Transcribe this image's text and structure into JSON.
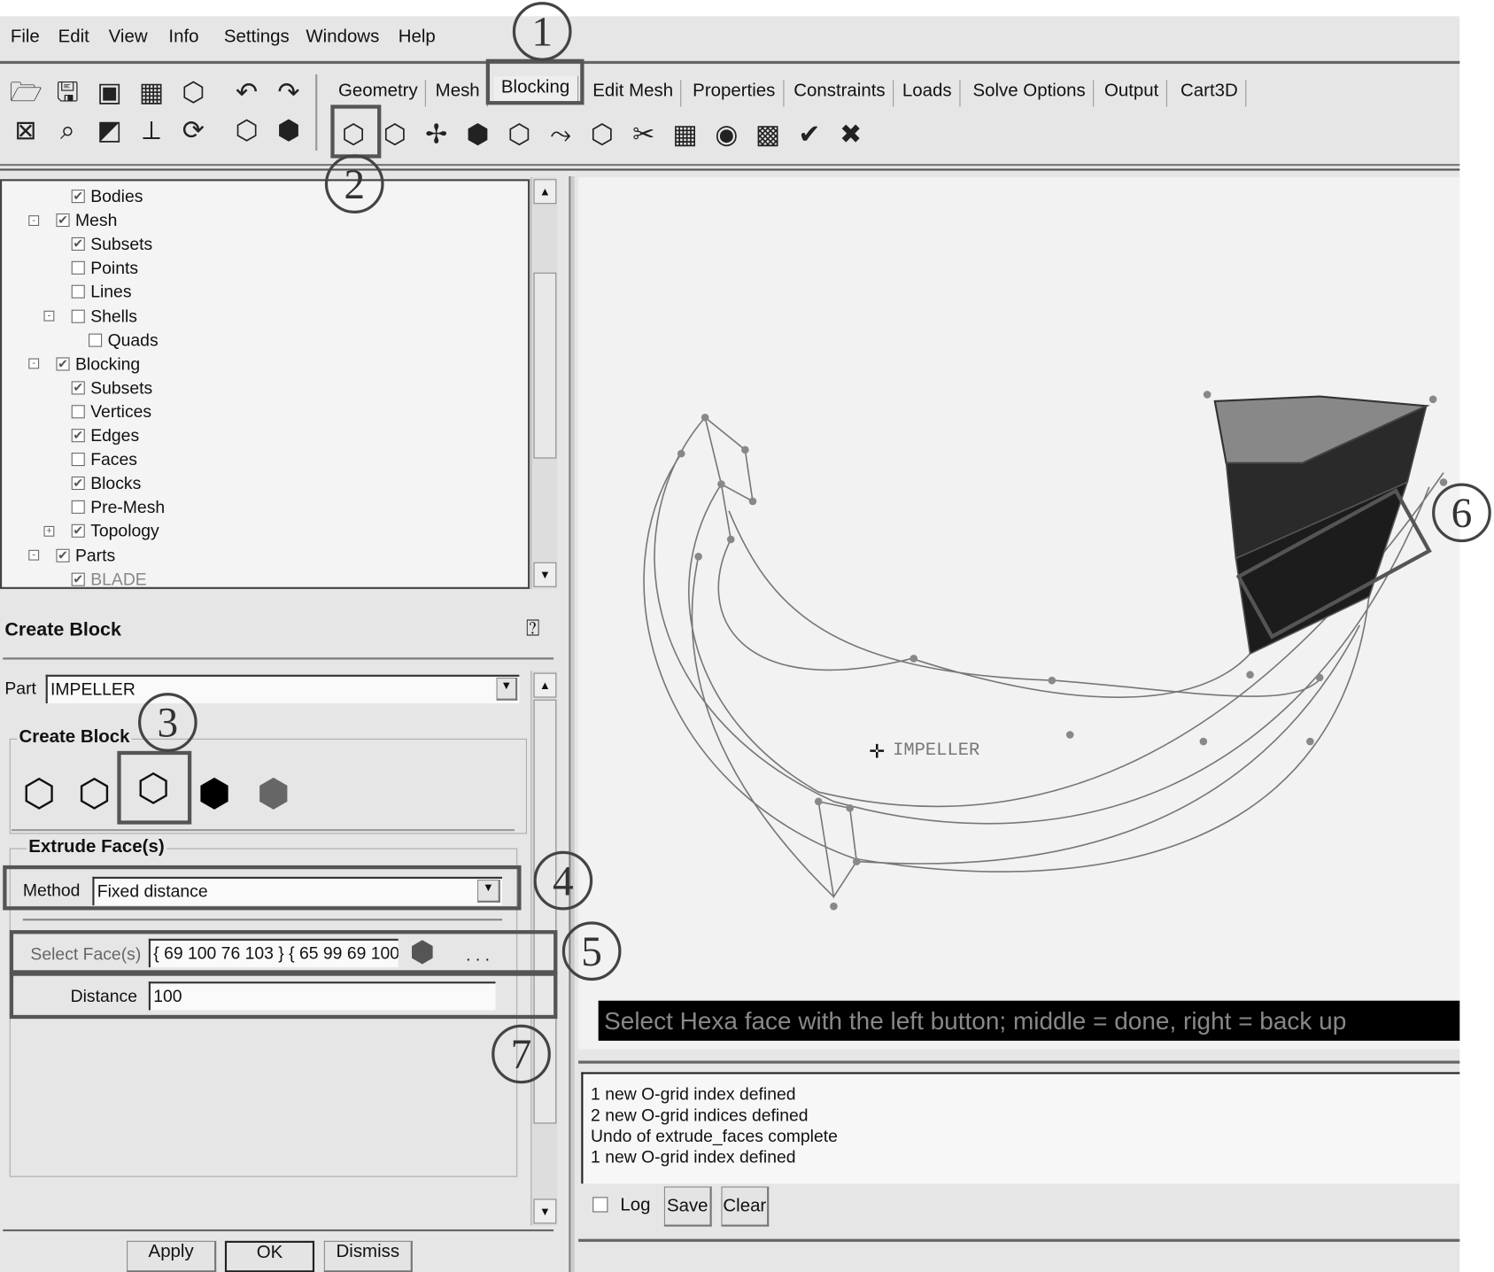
{
  "menu": [
    "File",
    "Edit",
    "View",
    "Info",
    "Settings",
    "Windows",
    "Help"
  ],
  "tabs": [
    "Geometry",
    "Mesh",
    "Blocking",
    "Edit Mesh",
    "Properties",
    "Constraints",
    "Loads",
    "Solve Options",
    "Output",
    "Cart3D"
  ],
  "active_tab": "Blocking",
  "toolbar_icons": [
    "open-folder",
    "save",
    "geometry-save",
    "mesh-save",
    "blocking-save",
    "undo",
    "redo",
    "fit-window",
    "zoom",
    "measure",
    "lcs",
    "refresh",
    "wireframe-shade",
    "solid-shade"
  ],
  "blocking_icons": [
    "create-block",
    "split-block",
    "merge-vertices",
    "edit-block",
    "associate",
    "move-vertex",
    "transform-blocks",
    "edit-edge",
    "pre-mesh-params",
    "pre-mesh-quality",
    "pre-mesh-smooth",
    "check-blocks",
    "delete-block"
  ],
  "tree": [
    {
      "label": "Bodies",
      "level": 3,
      "checked": true,
      "expander": ""
    },
    {
      "label": "Mesh",
      "level": 2,
      "checked": true,
      "expander": "-"
    },
    {
      "label": "Subsets",
      "level": 3,
      "checked": true,
      "expander": ""
    },
    {
      "label": "Points",
      "level": 3,
      "checked": false,
      "expander": ""
    },
    {
      "label": "Lines",
      "level": 3,
      "checked": false,
      "expander": ""
    },
    {
      "label": "Shells",
      "level": 3,
      "checked": false,
      "expander": "-"
    },
    {
      "label": "Quads",
      "level": 4,
      "checked": false,
      "expander": ""
    },
    {
      "label": "Blocking",
      "level": 2,
      "checked": true,
      "expander": "-"
    },
    {
      "label": "Subsets",
      "level": 3,
      "checked": true,
      "expander": ""
    },
    {
      "label": "Vertices",
      "level": 3,
      "checked": false,
      "expander": ""
    },
    {
      "label": "Edges",
      "level": 3,
      "checked": true,
      "expander": ""
    },
    {
      "label": "Faces",
      "level": 3,
      "checked": false,
      "expander": ""
    },
    {
      "label": "Blocks",
      "level": 3,
      "checked": true,
      "expander": ""
    },
    {
      "label": "Pre-Mesh",
      "level": 3,
      "checked": false,
      "expander": ""
    },
    {
      "label": "Topology",
      "level": 3,
      "checked": true,
      "expander": "+"
    },
    {
      "label": "Parts",
      "level": 2,
      "checked": true,
      "expander": "-"
    },
    {
      "label": "BLADE",
      "level": 3,
      "checked": true,
      "expander": ""
    }
  ],
  "panel": {
    "title": "Create Block",
    "part_label": "Part",
    "part_value": "IMPELLER",
    "group_title": "Create Block",
    "create_types": [
      "initialize-block",
      "from-vertices",
      "extrude-faces",
      "2d-to-3d",
      "3d-from-2d"
    ],
    "sub_title": "Extrude Face(s)",
    "method_label": "Method",
    "method_value": "Fixed distance",
    "select_label": "Select Face(s)",
    "select_value": "{ 69 100 76 103 } { 65 99 69 100",
    "select_more": ". . .",
    "distance_label": "Distance",
    "distance_value": "100",
    "apply": "Apply",
    "ok": "OK",
    "dismiss": "Dismiss"
  },
  "viewport": {
    "part_label": "IMPELLER",
    "status": "Select Hexa face with the left button; middle = done, right = back up"
  },
  "log": {
    "lines": [
      "1 new O-grid index defined",
      "2 new O-grid indices defined",
      "Undo of extrude_faces complete",
      "1 new O-grid index defined"
    ],
    "log_label": "Log",
    "save": "Save",
    "clear": "Clear"
  },
  "annotations": [
    "1",
    "2",
    "3",
    "4",
    "5",
    "6",
    "7"
  ]
}
